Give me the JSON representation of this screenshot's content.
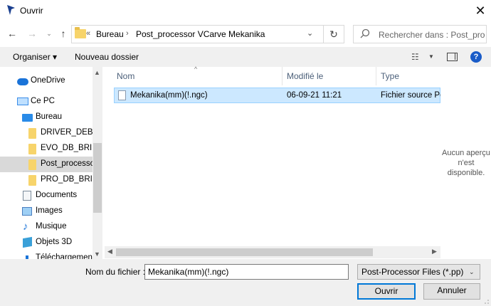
{
  "window": {
    "title": "Ouvrir",
    "close_glyph": "✕",
    "app_icon": "vcarve-arrow-icon"
  },
  "nav": {
    "back": "←",
    "forward": "→",
    "recent": "⌄",
    "up": "↑",
    "address": {
      "prefix": "«",
      "segments": [
        "Bureau",
        "Post_processor VCarve Mekanika"
      ],
      "separator": "›",
      "dropdown": "⌄"
    },
    "refresh": "↻",
    "search_placeholder": "Rechercher dans : Post_proc..."
  },
  "toolbar": {
    "organize": "Organiser ▾",
    "new_folder": "Nouveau dossier",
    "view_glyph": "☷",
    "view_dd": "▼",
    "help": "?"
  },
  "sidebar": {
    "items": [
      {
        "label": "OneDrive",
        "icon": "onedrive-icon"
      },
      {
        "label": "Ce PC",
        "icon": "pc-icon"
      },
      {
        "label": "Bureau",
        "icon": "desktop-icon"
      },
      {
        "label": "DRIVER_DEBUG",
        "icon": "folder-icon"
      },
      {
        "label": "EVO_DB_BRIDGE",
        "icon": "folder-icon"
      },
      {
        "label": "Post_processor",
        "icon": "folder-icon",
        "selected": true
      },
      {
        "label": "PRO_DB_BRIDGE",
        "icon": "folder-icon"
      },
      {
        "label": "Documents",
        "icon": "documents-icon"
      },
      {
        "label": "Images",
        "icon": "pictures-icon"
      },
      {
        "label": "Musique",
        "icon": "music-icon"
      },
      {
        "label": "Objets 3D",
        "icon": "3d-objects-icon"
      },
      {
        "label": "Téléchargements",
        "icon": "downloads-icon"
      }
    ],
    "scroll_up": "▲",
    "scroll_down": "▼"
  },
  "files": {
    "sort_glyph": "^",
    "columns": [
      "Nom",
      "Modifié le",
      "Type"
    ],
    "rows": [
      {
        "name": "Mekanika(mm)(!.ngc)",
        "modified": "06-09-21 11:21",
        "type": "Fichier source Per"
      }
    ],
    "hscroll_left": "◀",
    "hscroll_right": "▶"
  },
  "preview": {
    "text": "Aucun aperçu n'est disponible."
  },
  "footer": {
    "filename_label": "Nom du fichier :",
    "filename_value": "Mekanika(mm)(!.ngc)",
    "filetype": "Post-Processor Files (*.pp)",
    "filetype_dd": "⌄",
    "open_label": "Ouvrir",
    "cancel_label": "Annuler"
  },
  "colors": {
    "accent": "#0078d7",
    "selection": "#cce8ff",
    "folder": "#f7d46b",
    "help": "#1a5cc8"
  }
}
